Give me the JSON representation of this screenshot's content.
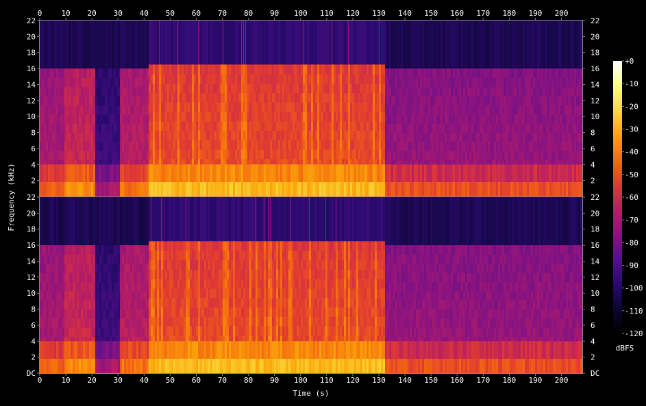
{
  "chart_data": {
    "type": "heatmap",
    "xlabel": "Time (s)",
    "ylabel": "Frequency (kHz)",
    "x_ticks": [
      "0",
      "10",
      "20",
      "30",
      "40",
      "50",
      "60",
      "70",
      "80",
      "90",
      "100",
      "110",
      "120",
      "130",
      "140",
      "150",
      "160",
      "170",
      "180",
      "190",
      "200"
    ],
    "y_ticks_top": [
      "22",
      "20",
      "18",
      "16",
      "14",
      "12",
      "10",
      "8",
      "6",
      "4",
      "2"
    ],
    "y_ticks_bottom": [
      "22",
      "20",
      "18",
      "16",
      "14",
      "12",
      "10",
      "8",
      "6",
      "4",
      "2",
      "DC"
    ],
    "x_range": [
      0,
      208
    ],
    "y_range": [
      0,
      22
    ],
    "channels": 2,
    "colorbar": {
      "label": "dBFS",
      "ticks": [
        "+0",
        "-10",
        "-20",
        "-30",
        "-40",
        "-50",
        "-60",
        "-70",
        "-80",
        "-90",
        "-100",
        "-110",
        "-120"
      ],
      "range": [
        -120,
        0
      ],
      "colormap": [
        "#000000",
        "#0b0630",
        "#2a0a6e",
        "#55108a",
        "#8a1380",
        "#b81e63",
        "#e03a32",
        "#f46a10",
        "#fca50a",
        "#f8d93a",
        "#fbfd8a",
        "#ffffff"
      ]
    },
    "background_color": "#000000",
    "frame_color": "#888888",
    "segments": [
      {
        "t": [
          0,
          9
        ],
        "cutoff_khz": 16,
        "level_db": -68
      },
      {
        "t": [
          9,
          21
        ],
        "cutoff_khz": 16,
        "level_db": -60
      },
      {
        "t": [
          21,
          30
        ],
        "cutoff_khz": 16,
        "level_db": -92
      },
      {
        "t": [
          30,
          41
        ],
        "cutoff_khz": 16,
        "level_db": -64
      },
      {
        "t": [
          41,
          132
        ],
        "cutoff_khz": 16.5,
        "level_db": -50
      },
      {
        "t": [
          132,
          208
        ],
        "cutoff_khz": 16,
        "level_db": -72
      }
    ]
  }
}
